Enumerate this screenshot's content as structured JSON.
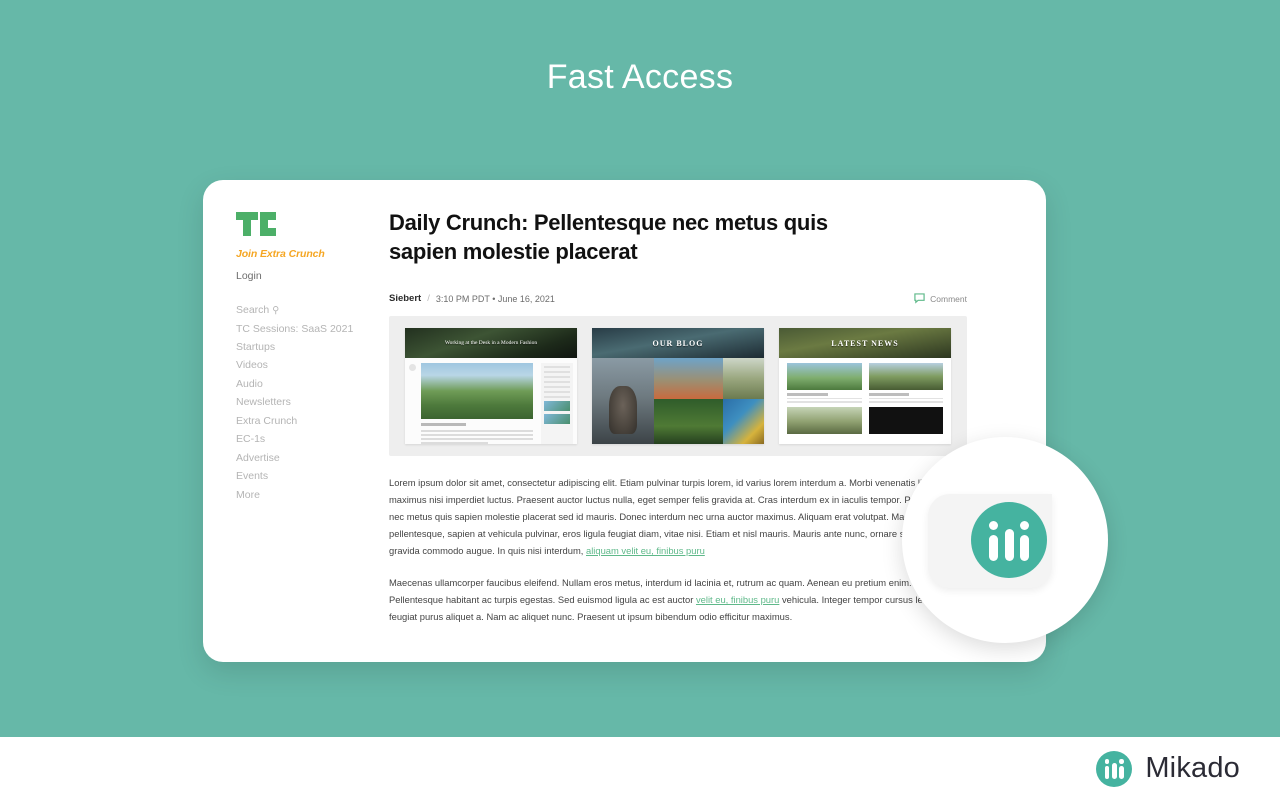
{
  "slide": {
    "title": "Fast Access",
    "background_color": "#66b8a8",
    "footer_background": "#ffffff"
  },
  "brand": {
    "name": "Mikado",
    "accent_color": "#45b3a0",
    "logo_icon": "mikado-people-icon"
  },
  "browser_card": {
    "sidebar": {
      "logo_icon": "techcrunch-tc-logo",
      "join_label": "Join Extra Crunch",
      "join_color": "#f5a623",
      "login_label": "Login",
      "items": [
        {
          "label": "Search",
          "icon": "search-icon",
          "has_icon": true
        },
        {
          "label": "TC Sessions: SaaS 2021",
          "has_icon": false
        },
        {
          "label": "Startups",
          "has_icon": false
        },
        {
          "label": "Videos",
          "has_icon": false
        },
        {
          "label": "Audio",
          "has_icon": false
        },
        {
          "label": "Newsletters",
          "has_icon": false
        },
        {
          "label": "Extra Crunch",
          "has_icon": false
        },
        {
          "label": "EC-1s",
          "has_icon": false
        },
        {
          "label": "Advertise",
          "has_icon": false
        },
        {
          "label": "Events",
          "has_icon": false
        },
        {
          "label": "More",
          "has_icon": false
        }
      ]
    },
    "article": {
      "title": "Daily Crunch: Pellentesque nec metus quis sapien molestie placerat",
      "author": "Siebert",
      "separator": "/",
      "meta": "3:10 PM PDT • June 16, 2021",
      "comment_label": "Comment",
      "comment_icon": "comment-bubble-icon",
      "comment_color": "#5fb98a",
      "gallery": {
        "background_color": "#eeeeee",
        "thumbnails": [
          {
            "name": "blog-template-preview-1",
            "hero_text": "Working at the Desk in a Modern Fashion"
          },
          {
            "name": "blog-template-preview-2",
            "hero_text": "OUR BLOG"
          },
          {
            "name": "blog-template-preview-3",
            "hero_text": "LATEST NEWS"
          }
        ]
      },
      "paragraphs": [
        {
          "before_link": "Lorem ipsum dolor sit amet, consectetur adipiscing elit. Etiam pulvinar turpis lorem, id varius lorem interdum a. Morbi venenatis libero maximus nisi imperdiet luctus. Praesent auctor luctus nulla, eget semper felis gravida at. Cras interdum ex in iaculis tempor. Pellentesque nec metus quis sapien molestie placerat sed id mauris. Donec interdum nec urna auctor maximus. Aliquam erat volutpat. Maecenas pellentesque, sapien at vehicula pulvinar, eros ligula feugiat diam, vitae nisi. Etiam et nisl mauris. Mauris ante nunc, ornare sit amet ex in, gravida commodo augue. In quis nisi interdum, ",
          "link": "aliquam velit eu, finibus puru",
          "after_link": ""
        },
        {
          "before_link": "Maecenas ullamcorper faucibus eleifend. Nullam eros metus, interdum id lacinia et, rutrum ac quam. Aenean eu pretium enim. Pellentesque habitant  ac turpis egestas. Sed euismod ligula ac est auctor ",
          "link": "velit eu, finibus puru",
          "after_link": " vehicula. Integer tempor cursus leo, eu feugiat purus aliquet a. Nam ac aliquet nunc. Praesent ut ipsum bibendum odio efficitur maximus."
        }
      ]
    }
  }
}
